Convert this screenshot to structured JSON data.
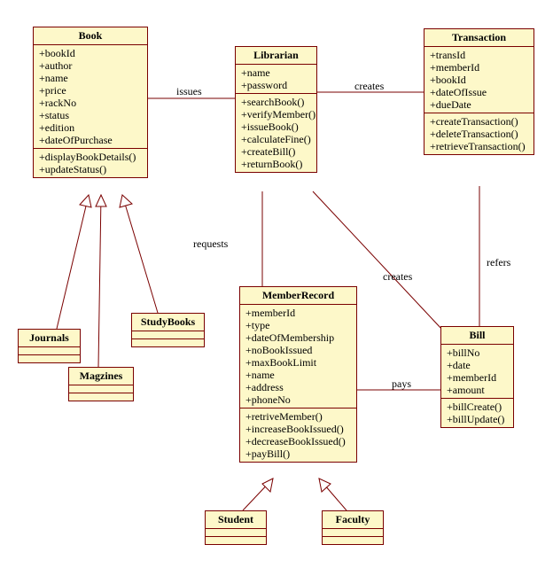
{
  "classes": {
    "book": {
      "title": "Book",
      "attrs": [
        "+bookId",
        "+author",
        "+name",
        "+price",
        "+rackNo",
        "+status",
        "+edition",
        "+dateOfPurchase"
      ],
      "ops": [
        "+displayBookDetails()",
        "+updateStatus()"
      ]
    },
    "librarian": {
      "title": "Librarian",
      "attrs": [
        "+name",
        "+password"
      ],
      "ops": [
        "+searchBook()",
        "+verifyMember()",
        "+issueBook()",
        "+calculateFine()",
        "+createBill()",
        "+returnBook()"
      ]
    },
    "transaction": {
      "title": "Transaction",
      "attrs": [
        "+transId",
        "+memberId",
        "+bookId",
        "+dateOfIssue",
        "+dueDate"
      ],
      "ops": [
        "+createTransaction()",
        "+deleteTransaction()",
        "+retrieveTransaction()"
      ]
    },
    "memberrecord": {
      "title": "MemberRecord",
      "attrs": [
        "+memberId",
        "+type",
        "+dateOfMembership",
        "+noBookIssued",
        "+maxBookLimit",
        "+name",
        "+address",
        "+phoneNo"
      ],
      "ops": [
        "+retriveMember()",
        "+increaseBookIssued()",
        "+decreaseBookIssued()",
        "+payBill()"
      ]
    },
    "bill": {
      "title": "Bill",
      "attrs": [
        "+billNo",
        "+date",
        "+memberId",
        "+amount"
      ],
      "ops": [
        "+billCreate()",
        "+billUpdate()"
      ]
    },
    "journals": {
      "title": "Journals"
    },
    "studybooks": {
      "title": "StudyBooks"
    },
    "magzines": {
      "title": "Magzines"
    },
    "student": {
      "title": "Student"
    },
    "faculty": {
      "title": "Faculty"
    }
  },
  "labels": {
    "issues": "issues",
    "creates1": "creates",
    "creates2": "creates",
    "refers": "refers",
    "requests": "requests",
    "pays": "pays"
  }
}
